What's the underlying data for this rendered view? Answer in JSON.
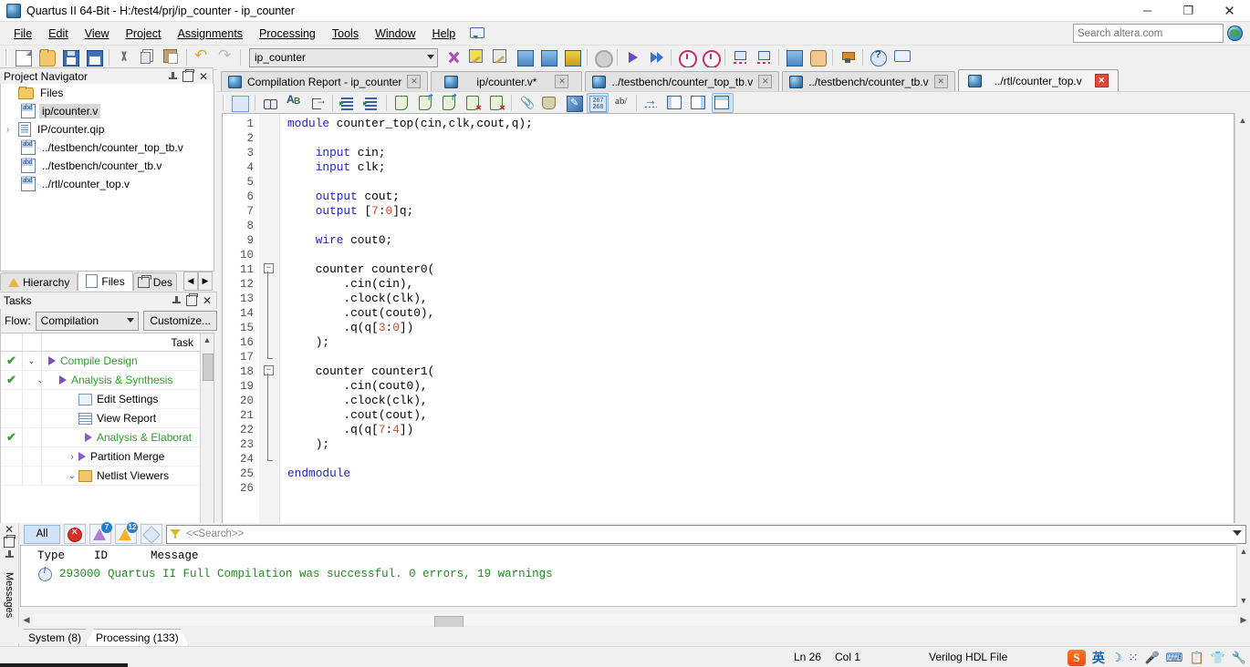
{
  "window": {
    "title": "Quartus II 64-Bit - H:/test4/prj/ip_counter - ip_counter",
    "minimize": "─",
    "maximize": "❐",
    "close": "✕"
  },
  "menubar": {
    "items": [
      "File",
      "Edit",
      "View",
      "Project",
      "Assignments",
      "Processing",
      "Tools",
      "Window",
      "Help"
    ]
  },
  "altera_search": {
    "placeholder": "Search altera.com",
    "value": ""
  },
  "toolbar": {
    "project_combo": "ip_counter",
    "buttons": [
      "new-file-icon",
      "open-file-icon",
      "save-file-icon",
      "save-all-icon",
      "cut-icon",
      "copy-icon",
      "paste-icon",
      "undo-icon",
      "redo-icon"
    ],
    "compile_buttons": [
      "start-compilation-icon",
      "analysis-synthesis-icon",
      "fitter-icon",
      "assembler-icon",
      "timing-analyzer-icon",
      "eda-netlist-icon",
      "stop-icon",
      "start-icon",
      "start-compilation-2-icon",
      "timing-analyzer-2-icon",
      "timing-analyzer-3-icon",
      "rtl-viewer-icon",
      "tech-map-viewer-icon",
      "programmer-icon",
      "pin-planner-icon",
      "assignment-editor-icon",
      "help-icon",
      "bubble-icon"
    ]
  },
  "project_navigator": {
    "title": "Project Navigator",
    "tree": [
      {
        "label": "Files",
        "icon": "folder-icon",
        "indent": 0,
        "twisty": "",
        "selected": false
      },
      {
        "label": "ip/counter.v",
        "icon": "verilog-file-icon",
        "indent": 1,
        "twisty": "",
        "selected": true
      },
      {
        "label": "IP/counter.qip",
        "icon": "qip-file-icon",
        "indent": 1,
        "twisty": "›",
        "selected": false
      },
      {
        "label": "../testbench/counter_top_tb.v",
        "icon": "verilog-file-icon",
        "indent": 1,
        "twisty": "",
        "selected": false
      },
      {
        "label": "../testbench/counter_tb.v",
        "icon": "verilog-file-icon",
        "indent": 1,
        "twisty": "",
        "selected": false
      },
      {
        "label": "../rtl/counter_top.v",
        "icon": "verilog-file-icon",
        "indent": 1,
        "twisty": "",
        "selected": false
      }
    ],
    "tabs": [
      {
        "label": "Hierarchy",
        "icon": "hierarchy-icon",
        "active": false
      },
      {
        "label": "Files",
        "icon": "files-icon",
        "active": true
      },
      {
        "label": "Des",
        "icon": "design-units-icon",
        "active": false
      }
    ],
    "nav_prev": "◀",
    "nav_next": "▶"
  },
  "tasks": {
    "title": "Tasks",
    "flow_label": "Flow:",
    "flow_value": "Compilation",
    "customize_label": "Customize...",
    "column_header": "Task",
    "rows": [
      {
        "check": "✔",
        "twisty": "⌄",
        "indent": 0,
        "icon": "play-icon",
        "label": "Compile Design",
        "green": true
      },
      {
        "check": "✔",
        "twisty": "⌄",
        "indent": 1,
        "icon": "play-icon",
        "label": "Analysis & Synthesis",
        "green": true
      },
      {
        "check": "",
        "twisty": "",
        "indent": 2,
        "icon": "edit-settings-icon",
        "label": "Edit Settings",
        "green": false
      },
      {
        "check": "",
        "twisty": "",
        "indent": 2,
        "icon": "view-report-icon",
        "label": "View Report",
        "green": false
      },
      {
        "check": "✔",
        "twisty": "",
        "indent": 2,
        "icon": "play-icon",
        "label": "Analysis & Elaborat",
        "green": true
      },
      {
        "check": "",
        "twisty": "›",
        "indent": 2,
        "icon": "play-icon",
        "label": "Partition Merge",
        "green": false
      },
      {
        "check": "",
        "twisty": "⌄",
        "indent": 2,
        "icon": "folder-icon",
        "label": "Netlist Viewers",
        "green": false
      }
    ]
  },
  "editor_tabs": [
    {
      "label": "Compilation Report - ip_counter",
      "active": false,
      "close_red": false
    },
    {
      "label": "ip/counter.v*",
      "active": false,
      "close_red": false
    },
    {
      "label": "../testbench/counter_top_tb.v",
      "active": false,
      "close_red": false
    },
    {
      "label": "../testbench/counter_tb.v",
      "active": false,
      "close_red": false
    },
    {
      "label": "../rtl/counter_top.v",
      "active": true,
      "close_red": true
    }
  ],
  "editor_toolbar": {
    "buttons": [
      "insert-template-icon",
      "find-icon",
      "replace-icon",
      "goto-line-icon",
      "increase-indent-icon",
      "decrease-indent-icon",
      "toggle-bookmark-icon",
      "next-bookmark-icon",
      "previous-bookmark-icon",
      "clear-bookmark-icon",
      "clear-all-bookmarks-icon",
      "attach-icon",
      "archive-icon",
      "comment-icon",
      "line-numbers-icon",
      "toggle-wrap-icon",
      "find-matching-delimiter-icon",
      "split-left-icon",
      "split-right-icon",
      "split-top-icon"
    ],
    "line_number_badge": "267\n268",
    "ab_label": "ab/"
  },
  "code": {
    "line_count": 26,
    "lines": [
      {
        "n": 1,
        "text": "module counter_top(cin,clk,cout,q);",
        "kw": "module"
      },
      {
        "n": 2,
        "text": ""
      },
      {
        "n": 3,
        "text": "    input cin;",
        "kw": "input"
      },
      {
        "n": 4,
        "text": "    input clk;",
        "kw": "input"
      },
      {
        "n": 5,
        "text": ""
      },
      {
        "n": 6,
        "text": "    output cout;",
        "kw": "output"
      },
      {
        "n": 7,
        "text": "    output [7:0]q;",
        "kw": "output"
      },
      {
        "n": 8,
        "text": ""
      },
      {
        "n": 9,
        "text": "    wire cout0;",
        "kw": "wire"
      },
      {
        "n": 10,
        "text": ""
      },
      {
        "n": 11,
        "text": "    counter counter0("
      },
      {
        "n": 12,
        "text": "        .cin(cin),"
      },
      {
        "n": 13,
        "text": "        .clock(clk),"
      },
      {
        "n": 14,
        "text": "        .cout(cout0),"
      },
      {
        "n": 15,
        "text": "        .q(q[3:0])"
      },
      {
        "n": 16,
        "text": "    );"
      },
      {
        "n": 17,
        "text": ""
      },
      {
        "n": 18,
        "text": "    counter counter1("
      },
      {
        "n": 19,
        "text": "        .cin(cout0),"
      },
      {
        "n": 20,
        "text": "        .clock(clk),"
      },
      {
        "n": 21,
        "text": "        .cout(cout),"
      },
      {
        "n": 22,
        "text": "        .q(q[7:4])"
      },
      {
        "n": 23,
        "text": "    );"
      },
      {
        "n": 24,
        "text": ""
      },
      {
        "n": 25,
        "text": "endmodule",
        "kw": "endmodule"
      },
      {
        "n": 26,
        "text": ""
      }
    ]
  },
  "messages": {
    "panel_label": "Messages",
    "filter_all": "All",
    "error_badge": "",
    "critical_badge": "7",
    "warning_badge": "12",
    "info_badge": "",
    "search_placeholder": "<<Search>>",
    "columns": [
      "Type",
      "ID",
      "Message"
    ],
    "rows": [
      {
        "type_icon": "info-icon",
        "id": "293000",
        "message": "Quartus II Full Compilation was successful. 0 errors, 19 warnings"
      }
    ]
  },
  "bottom_tabs": [
    {
      "label": "System (8)",
      "active": false
    },
    {
      "label": "Processing (133)",
      "active": true
    }
  ],
  "statusbar": {
    "line": "Ln 26",
    "column": "Col 1",
    "file_type": "Verilog HDL File",
    "ime": [
      "S",
      "英",
      "☽",
      "⁙",
      "mic-icon",
      "keyboard-icon",
      "clipboard-icon",
      "skin-icon",
      "wrench-icon"
    ]
  },
  "colors": {
    "keyword": "#2222cc",
    "number": "#d2452a",
    "success_text": "#1f8a1f",
    "task_green": "#2e9c2e",
    "accent": "#3a6ea8"
  }
}
